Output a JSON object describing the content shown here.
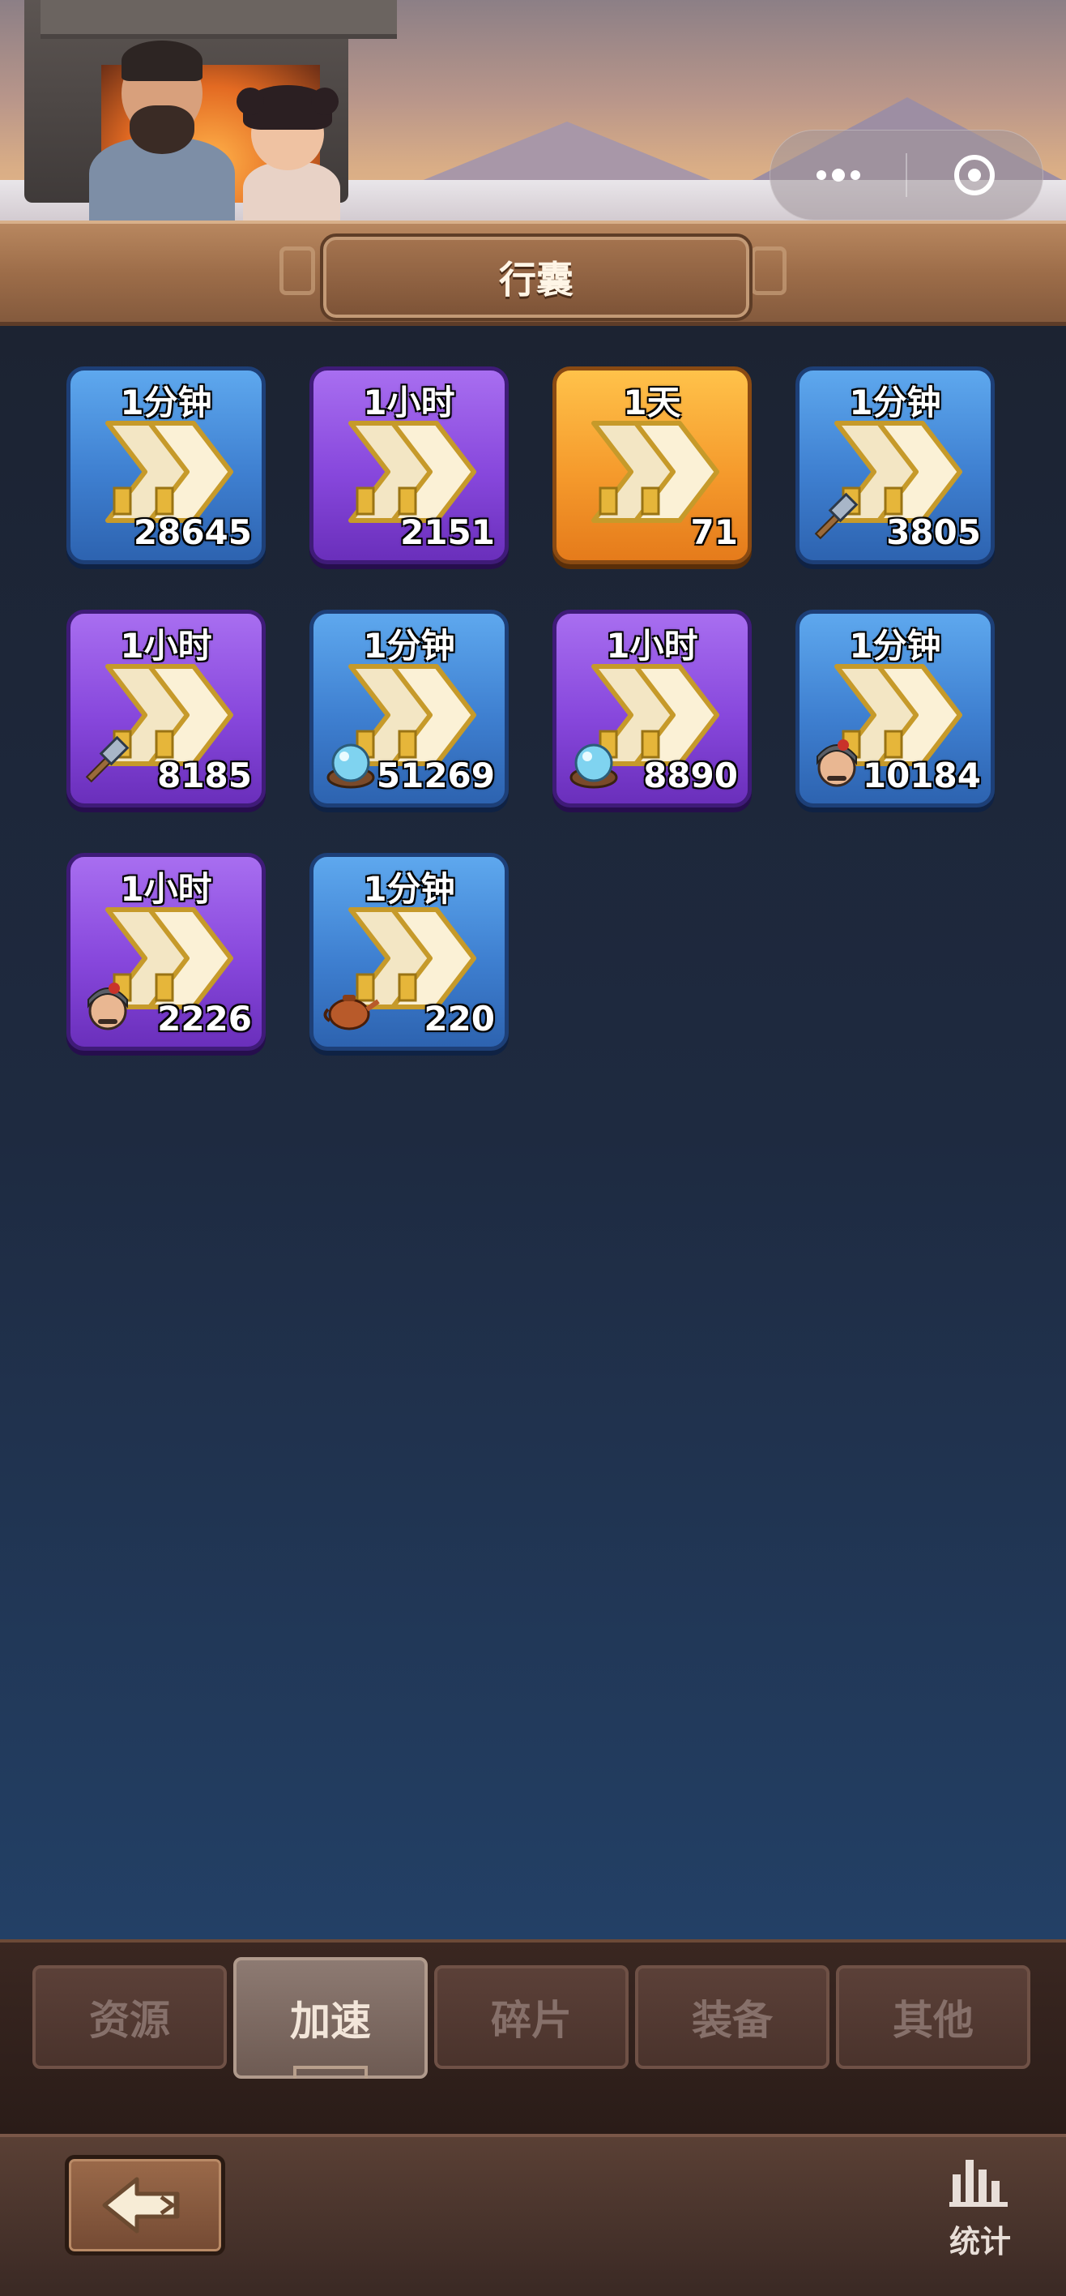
{
  "header": {
    "title": "行囊"
  },
  "capsule": {
    "more_icon": "more-dots-icon",
    "close_icon": "target-circle-icon"
  },
  "items": [
    {
      "label": "1分钟",
      "count": "28645",
      "color": "blue",
      "badge": ""
    },
    {
      "label": "1小时",
      "count": "2151",
      "color": "purple",
      "badge": ""
    },
    {
      "label": "1天",
      "count": "71",
      "color": "orange",
      "badge": ""
    },
    {
      "label": "1分钟",
      "count": "3805",
      "color": "blue",
      "badge": "hammer-icon"
    },
    {
      "label": "1小时",
      "count": "8185",
      "color": "purple",
      "badge": "hammer-icon"
    },
    {
      "label": "1分钟",
      "count": "51269",
      "color": "blue",
      "badge": "crystal-ball-icon"
    },
    {
      "label": "1小时",
      "count": "8890",
      "color": "purple",
      "badge": "crystal-ball-icon"
    },
    {
      "label": "1分钟",
      "count": "10184",
      "color": "blue",
      "badge": "soldier-icon"
    },
    {
      "label": "1小时",
      "count": "2226",
      "color": "purple",
      "badge": "soldier-icon"
    },
    {
      "label": "1分钟",
      "count": "220",
      "color": "blue",
      "badge": "teapot-icon"
    }
  ],
  "tabs": [
    {
      "label": "资源",
      "active": false
    },
    {
      "label": "加速",
      "active": true
    },
    {
      "label": "碎片",
      "active": false
    },
    {
      "label": "装备",
      "active": false
    },
    {
      "label": "其他",
      "active": false
    }
  ],
  "bottom": {
    "back_icon": "back-arrow-icon",
    "stats_label": "统计",
    "stats_icon": "bar-chart-icon"
  },
  "colors": {
    "blue_item": "#3e7fd0",
    "purple_item": "#8747dc",
    "orange_item": "#f59a2c",
    "background": "#1c2332"
  }
}
